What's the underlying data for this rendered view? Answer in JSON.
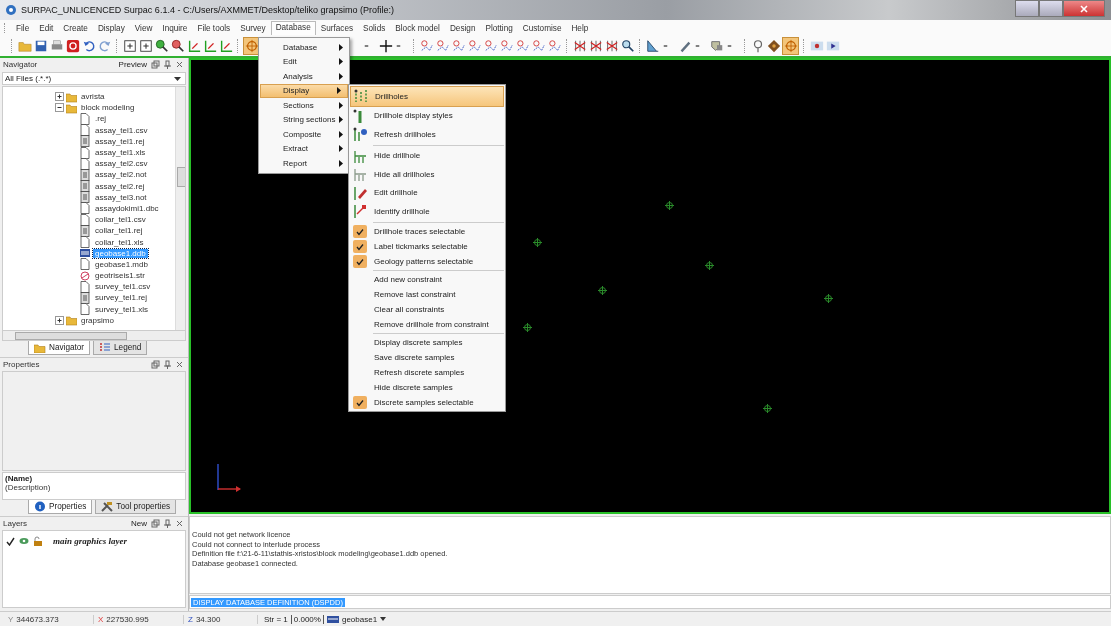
{
  "window": {
    "title": "SURPAC_UNLICENCED Surpac 6.1.4 - C:/Users/AXMMET/Desktop/teliko grapsimo (Profile:)"
  },
  "menu_bar": [
    {
      "label": "File",
      "selected": false
    },
    {
      "label": "Edit",
      "selected": false
    },
    {
      "label": "Create",
      "selected": false
    },
    {
      "label": "Display",
      "selected": false
    },
    {
      "label": "View",
      "selected": false
    },
    {
      "label": "Inquire",
      "selected": false
    },
    {
      "label": "File tools",
      "selected": false
    },
    {
      "label": "Survey",
      "selected": false
    },
    {
      "label": "Database",
      "selected": true
    },
    {
      "label": "Surfaces",
      "selected": false
    },
    {
      "label": "Solids",
      "selected": false
    },
    {
      "label": "Block model",
      "selected": false
    },
    {
      "label": "Design",
      "selected": false
    },
    {
      "label": "Plotting",
      "selected": false
    },
    {
      "label": "Customise",
      "selected": false
    },
    {
      "label": "Help",
      "selected": false
    }
  ],
  "database_menu": [
    {
      "label": "Database",
      "selected": false
    },
    {
      "label": "Edit",
      "selected": false
    },
    {
      "label": "Analysis",
      "selected": false
    },
    {
      "label": "Display",
      "selected": true
    },
    {
      "label": "Sections",
      "selected": false
    },
    {
      "label": "String sections",
      "selected": false
    },
    {
      "label": "Composite",
      "selected": false
    },
    {
      "label": "Extract",
      "selected": false
    },
    {
      "label": "Report",
      "selected": false
    }
  ],
  "display_submenu": {
    "groups": [
      [
        {
          "label": "Drillholes",
          "kind": "icon",
          "selected": true
        },
        {
          "label": "Drillhole display styles",
          "kind": "icon",
          "selected": false
        },
        {
          "label": "Refresh drillholes",
          "kind": "icon",
          "selected": false
        }
      ],
      [
        {
          "label": "Hide drillhole",
          "kind": "icon",
          "selected": false
        },
        {
          "label": "Hide all drillholes",
          "kind": "icon",
          "selected": false
        },
        {
          "label": "Edit drillhole",
          "kind": "icon",
          "selected": false
        },
        {
          "label": "Identify drillhole",
          "kind": "icon",
          "selected": false
        }
      ],
      [
        {
          "label": "Drillhole traces selectable",
          "kind": "check",
          "checked": true,
          "selected": false
        },
        {
          "label": "Label tickmarks selectable",
          "kind": "check",
          "checked": true,
          "selected": false
        },
        {
          "label": "Geology patterns selectable",
          "kind": "check",
          "checked": true,
          "selected": false
        }
      ],
      [
        {
          "label": "Add new constraint",
          "kind": "plain",
          "selected": false
        },
        {
          "label": "Remove last constraint",
          "kind": "plain",
          "selected": false
        },
        {
          "label": "Clear all constraints",
          "kind": "plain",
          "selected": false
        },
        {
          "label": "Remove drillhole from constraint",
          "kind": "plain",
          "selected": false
        }
      ],
      [
        {
          "label": "Display discrete samples",
          "kind": "plain",
          "selected": false
        },
        {
          "label": "Save discrete samples",
          "kind": "plain",
          "selected": false
        },
        {
          "label": "Refresh discrete samples",
          "kind": "plain",
          "selected": false
        },
        {
          "label": "Hide discrete samples",
          "kind": "plain",
          "selected": false
        },
        {
          "label": "Discrete samples selectable",
          "kind": "check",
          "checked": true,
          "selected": false
        }
      ]
    ]
  },
  "navigator": {
    "title": "Navigator",
    "preview": "Preview",
    "filter": "All Files (.*.*)",
    "tree": [
      {
        "label": "avrista",
        "kind": "folder",
        "expanded": false,
        "selected": false
      },
      {
        "label": "block modeling",
        "kind": "folder",
        "expanded": true,
        "selected": false,
        "children": [
          {
            "label": ".rej",
            "kind": "file",
            "selected": false
          },
          {
            "label": "assay_tel1.csv",
            "kind": "file",
            "selected": false
          },
          {
            "label": "assay_tel1.rej",
            "kind": "doc",
            "selected": false
          },
          {
            "label": "assay_tel1.xls",
            "kind": "file",
            "selected": false
          },
          {
            "label": "assay_tel2.csv",
            "kind": "file",
            "selected": false
          },
          {
            "label": "assay_tel2.not",
            "kind": "doc",
            "selected": false
          },
          {
            "label": "assay_tel2.rej",
            "kind": "doc",
            "selected": false
          },
          {
            "label": "assay_tel3.not",
            "kind": "doc",
            "selected": false
          },
          {
            "label": "assaydokimi1.dbc",
            "kind": "file",
            "selected": false
          },
          {
            "label": "collar_tel1.csv",
            "kind": "file",
            "selected": false
          },
          {
            "label": "collar_tel1.rej",
            "kind": "doc",
            "selected": false
          },
          {
            "label": "collar_tel1.xls",
            "kind": "file",
            "selected": false
          },
          {
            "label": "geobase1.ddb",
            "kind": "db",
            "selected": true
          },
          {
            "label": "geobase1.mdb",
            "kind": "file",
            "selected": false
          },
          {
            "label": "geotriseis1.str",
            "kind": "str",
            "selected": false
          },
          {
            "label": "survey_tel1.csv",
            "kind": "file",
            "selected": false
          },
          {
            "label": "survey_tel1.rej",
            "kind": "doc",
            "selected": false
          },
          {
            "label": "survey_tel1.xls",
            "kind": "file",
            "selected": false
          }
        ]
      },
      {
        "label": "grapsimo",
        "kind": "folder",
        "expanded": false,
        "selected": false
      }
    ],
    "tabs": [
      {
        "label": "Navigator",
        "selected": true
      },
      {
        "label": "Legend",
        "selected": false
      }
    ]
  },
  "properties": {
    "title": "Properties",
    "name": "(Name)",
    "description": "(Description)",
    "tabs": [
      {
        "label": "Properties",
        "selected": true
      },
      {
        "label": "Tool properties",
        "selected": false
      }
    ]
  },
  "layers": {
    "title": "Layers",
    "new": "New",
    "items": [
      {
        "label": "main graphics layer",
        "checked": true
      }
    ]
  },
  "console": {
    "lines": [
      "Could not get network licence",
      "Could not connect to interlude process",
      "Definition file f:\\21-6-11\\stathis-xristos\\block modeling\\geobase1.ddb opened.",
      "Database geobase1 connected."
    ],
    "command": "DISPLAY DATABASE DEFINITION (DSPDD)"
  },
  "status_bar": {
    "coords": [
      {
        "label": "Y",
        "value": "344673.373"
      },
      {
        "label": "X",
        "value": "227530.995"
      },
      {
        "label": "Z",
        "value": "34.300"
      }
    ],
    "string": "Str = 1",
    "percent": "0.000%",
    "layer": "geobase1"
  }
}
